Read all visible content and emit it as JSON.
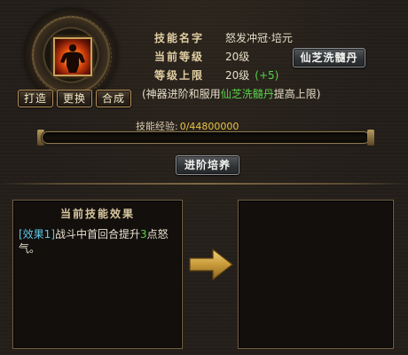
{
  "skill": {
    "name_label": "技能名字",
    "name_value": "怒发冲冠·培元",
    "current_level_label": "当前等级",
    "current_level_value": "20级",
    "max_level_label": "等级上限",
    "max_level_value": "20级",
    "max_level_bonus": "(+5)",
    "icon": "flaming-warrior-icon"
  },
  "buttons": {
    "forge": "打造",
    "replace": "更换",
    "combine": "合成",
    "wash": "仙芝洗髓丹",
    "advance": "进阶培养"
  },
  "note": {
    "prefix": "(神器进阶和服用",
    "highlight": "仙芝洗髓丹",
    "suffix": "提高上限)"
  },
  "experience": {
    "label": "技能经验:",
    "value": "0/44800000",
    "progress": 0
  },
  "effect": {
    "title": "当前技能效果",
    "tag": "[效果1]",
    "text_before": "战斗中首回合提升",
    "number": "3",
    "text_after": "点怒气。"
  },
  "colors": {
    "highlight_green": "#59d24a",
    "effect_tag_blue": "#5fc8e8",
    "exp_value_gold": "#e9c24a"
  }
}
